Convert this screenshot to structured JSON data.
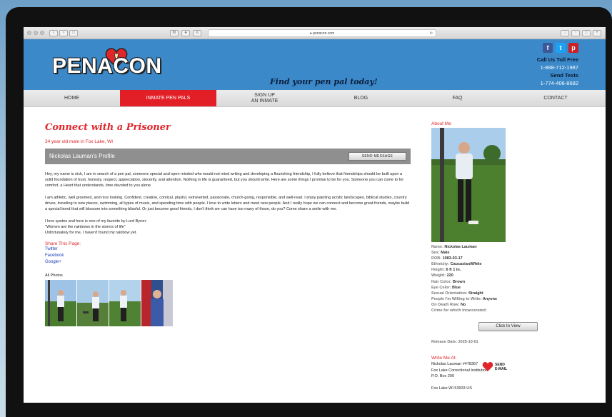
{
  "browser": {
    "url": "penacon.com"
  },
  "header": {
    "logo_text": "PENACON",
    "tagline": "Find your pen pal today!",
    "social": [
      {
        "label": "f",
        "icon": "facebook-icon",
        "color": "#3b5998"
      },
      {
        "label": "t",
        "icon": "twitter-icon",
        "color": "#1da1f2"
      },
      {
        "label": "p",
        "icon": "pinterest-icon",
        "color": "#cb2027"
      }
    ],
    "call_label": "Call Us Toll Free",
    "call_number": "1-888-712-1987",
    "text_label": "Send Texts",
    "text_number": "1-774-406-8682"
  },
  "nav": {
    "items": [
      {
        "label": "HOME",
        "active": false
      },
      {
        "label": "INMATE PEN PALS",
        "active": true
      },
      {
        "label": "SIGN UP\nAN INMATE",
        "active": false
      },
      {
        "label": "BLOG",
        "active": false
      },
      {
        "label": "FAQ",
        "active": false
      },
      {
        "label": "CONTACT",
        "active": false
      }
    ]
  },
  "profile": {
    "page_title": "Connect with a Prisoner",
    "subtitle": "34 year old male in Fox Lake, WI",
    "profile_heading": "Nickolas Lauman's Profile",
    "send_message_label": "SEND MESSAGE",
    "paragraphs": [
      "Hey, my name is nick, I am in search of a pen pal, someone special and open minded who would not mind writing and developing a flourishing friendship, I fully believe that friendships should be built upon a solid foundation of trust, honesty, respect, appreciation, sincerity, and attention. Nothing in life is guaranteed, but you should write. Here are some things I promise to be for you. Someone you can come to for comfort, a Heart that understands, time devoted to you alone.",
      "I am athletic, well groomed, and nice looking. Confident, creative, comical, playful, extraverted, passionate, church-going, responsible, and well-read. I enjoy painting acrylic landscapes, biblical studies, country drives, traveling to new places, swimming, all types of music, and spending time with people. I love to write letters and meet new people. And I really hope we can connect and become great friends, maybe build a special bond that will blossom into something blissful. Or just become good friends, I don't think we can have too many of those, do you? Come share a smile with me.",
      "I love quotes and here is one of my favorite by Lord Byron:\n\"Women are the rainbows in the storms of life\"\nUnfortunately for me, I haven't found my rainbow yet."
    ],
    "share_title": "Share This Page:",
    "share_links": [
      "Twitter",
      "Facebook",
      "Google+"
    ],
    "photos_label": "All Photos"
  },
  "about": {
    "title": "About Me",
    "fields": [
      {
        "k": "Name:",
        "v": "Nickolas Lauman"
      },
      {
        "k": "Sex:",
        "v": "Male"
      },
      {
        "k": "DOB:",
        "v": "1983-03-17"
      },
      {
        "k": "Ethnicity:",
        "v": "Caucasian/White"
      },
      {
        "k": "Height:",
        "v": "6 ft 1 in."
      },
      {
        "k": "Weight:",
        "v": "220"
      },
      {
        "k": "Hair Color:",
        "v": "Brown"
      },
      {
        "k": "Eye Color:",
        "v": "Blue"
      },
      {
        "k": "Sexual Orientation:",
        "v": "Straight"
      },
      {
        "k": "People I'm Willing to Write:",
        "v": "Anyone"
      },
      {
        "k": "On Death Row:",
        "v": "No"
      },
      {
        "k": "Crime for which incarcerated:",
        "v": ""
      }
    ],
    "click_to_view": "Click to View",
    "release_label": "Release Date:",
    "release_date": "2025-10-01",
    "write_title": "Write Me At:",
    "address_lines": [
      "Nickolas Lauman #478367",
      "Fox Lake Correctional Institution",
      "P.O. Box 200",
      "",
      "Fox Lake WI 53933 US"
    ],
    "send_email_label": "SEND\nE-MAIL"
  }
}
